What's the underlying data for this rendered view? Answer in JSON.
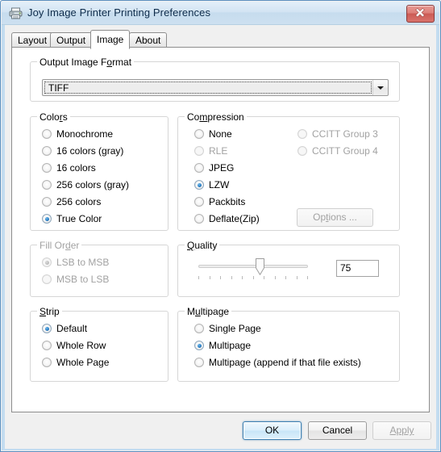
{
  "window": {
    "title": "Joy Image Printer Printing Preferences",
    "icon": "printer-icon",
    "close_label": "x"
  },
  "tabs": [
    {
      "label": "Layout",
      "active": false
    },
    {
      "label": "Output",
      "active": false
    },
    {
      "label": "Image",
      "active": true
    },
    {
      "label": "About",
      "active": false
    }
  ],
  "output_image_format": {
    "legend_pre": "Output Image F",
    "legend_accel": "o",
    "legend_post": "rmat",
    "selected": "TIFF"
  },
  "colors": {
    "legend_pre": "Colo",
    "legend_accel": "r",
    "legend_post": "s",
    "options": [
      {
        "label": "Monochrome",
        "checked": false,
        "disabled": false
      },
      {
        "label": "16 colors (gray)",
        "checked": false,
        "disabled": false
      },
      {
        "label": "16 colors",
        "checked": false,
        "disabled": false
      },
      {
        "label": "256 colors (gray)",
        "checked": false,
        "disabled": false
      },
      {
        "label": "256 colors",
        "checked": false,
        "disabled": false
      },
      {
        "label": "True Color",
        "checked": true,
        "disabled": false
      }
    ]
  },
  "compression": {
    "legend_pre": "Co",
    "legend_accel": "m",
    "legend_post": "pression",
    "options_left": [
      {
        "label": "None",
        "checked": false,
        "disabled": false
      },
      {
        "label": "RLE",
        "checked": false,
        "disabled": true
      },
      {
        "label": "JPEG",
        "checked": false,
        "disabled": false
      },
      {
        "label": "LZW",
        "checked": true,
        "disabled": false
      },
      {
        "label": "Packbits",
        "checked": false,
        "disabled": false
      },
      {
        "label": "Deflate(Zip)",
        "checked": false,
        "disabled": false
      }
    ],
    "options_right": [
      {
        "label": "CCITT Group 3",
        "checked": false,
        "disabled": true
      },
      {
        "label": "CCITT Group 4",
        "checked": false,
        "disabled": true
      }
    ],
    "options_button": {
      "label_pre": "Op",
      "label_accel": "t",
      "label_post": "ions ...",
      "disabled": true
    }
  },
  "fill_order": {
    "legend_pre": "Fill Or",
    "legend_accel": "d",
    "legend_post": "er",
    "disabled": true,
    "options": [
      {
        "label": "LSB to MSB",
        "checked": true,
        "disabled": true
      },
      {
        "label": "MSB to LSB",
        "checked": false,
        "disabled": true
      }
    ]
  },
  "quality": {
    "legend_pre": "",
    "legend_accel": "Q",
    "legend_post": "uality",
    "value": "75",
    "min": 0,
    "max": 100,
    "tick_count": 11
  },
  "strip": {
    "legend_pre": "",
    "legend_accel": "S",
    "legend_post": "trip",
    "options": [
      {
        "label": "Default",
        "checked": true,
        "disabled": false
      },
      {
        "label": "Whole Row",
        "checked": false,
        "disabled": false
      },
      {
        "label": "Whole Page",
        "checked": false,
        "disabled": false
      }
    ]
  },
  "multipage": {
    "legend_pre": "M",
    "legend_accel": "u",
    "legend_post": "ltipage",
    "options": [
      {
        "label": "Single Page",
        "checked": false,
        "disabled": false
      },
      {
        "label": "Multipage",
        "checked": true,
        "disabled": false
      },
      {
        "label": "Multipage (append if that file exists)",
        "checked": false,
        "disabled": false
      }
    ]
  },
  "footer": {
    "ok_label": "OK",
    "cancel_label": "Cancel",
    "apply_label": "Apply",
    "apply_disabled": true
  },
  "colors_palette": {
    "accent": "#2c81c8",
    "title_text": "#0d2b4a",
    "disabled_text": "#a2a2a2",
    "dialog_bg": "#f0f0f0",
    "panel_bg": "#ffffff",
    "close_red": "#cc5b55"
  }
}
